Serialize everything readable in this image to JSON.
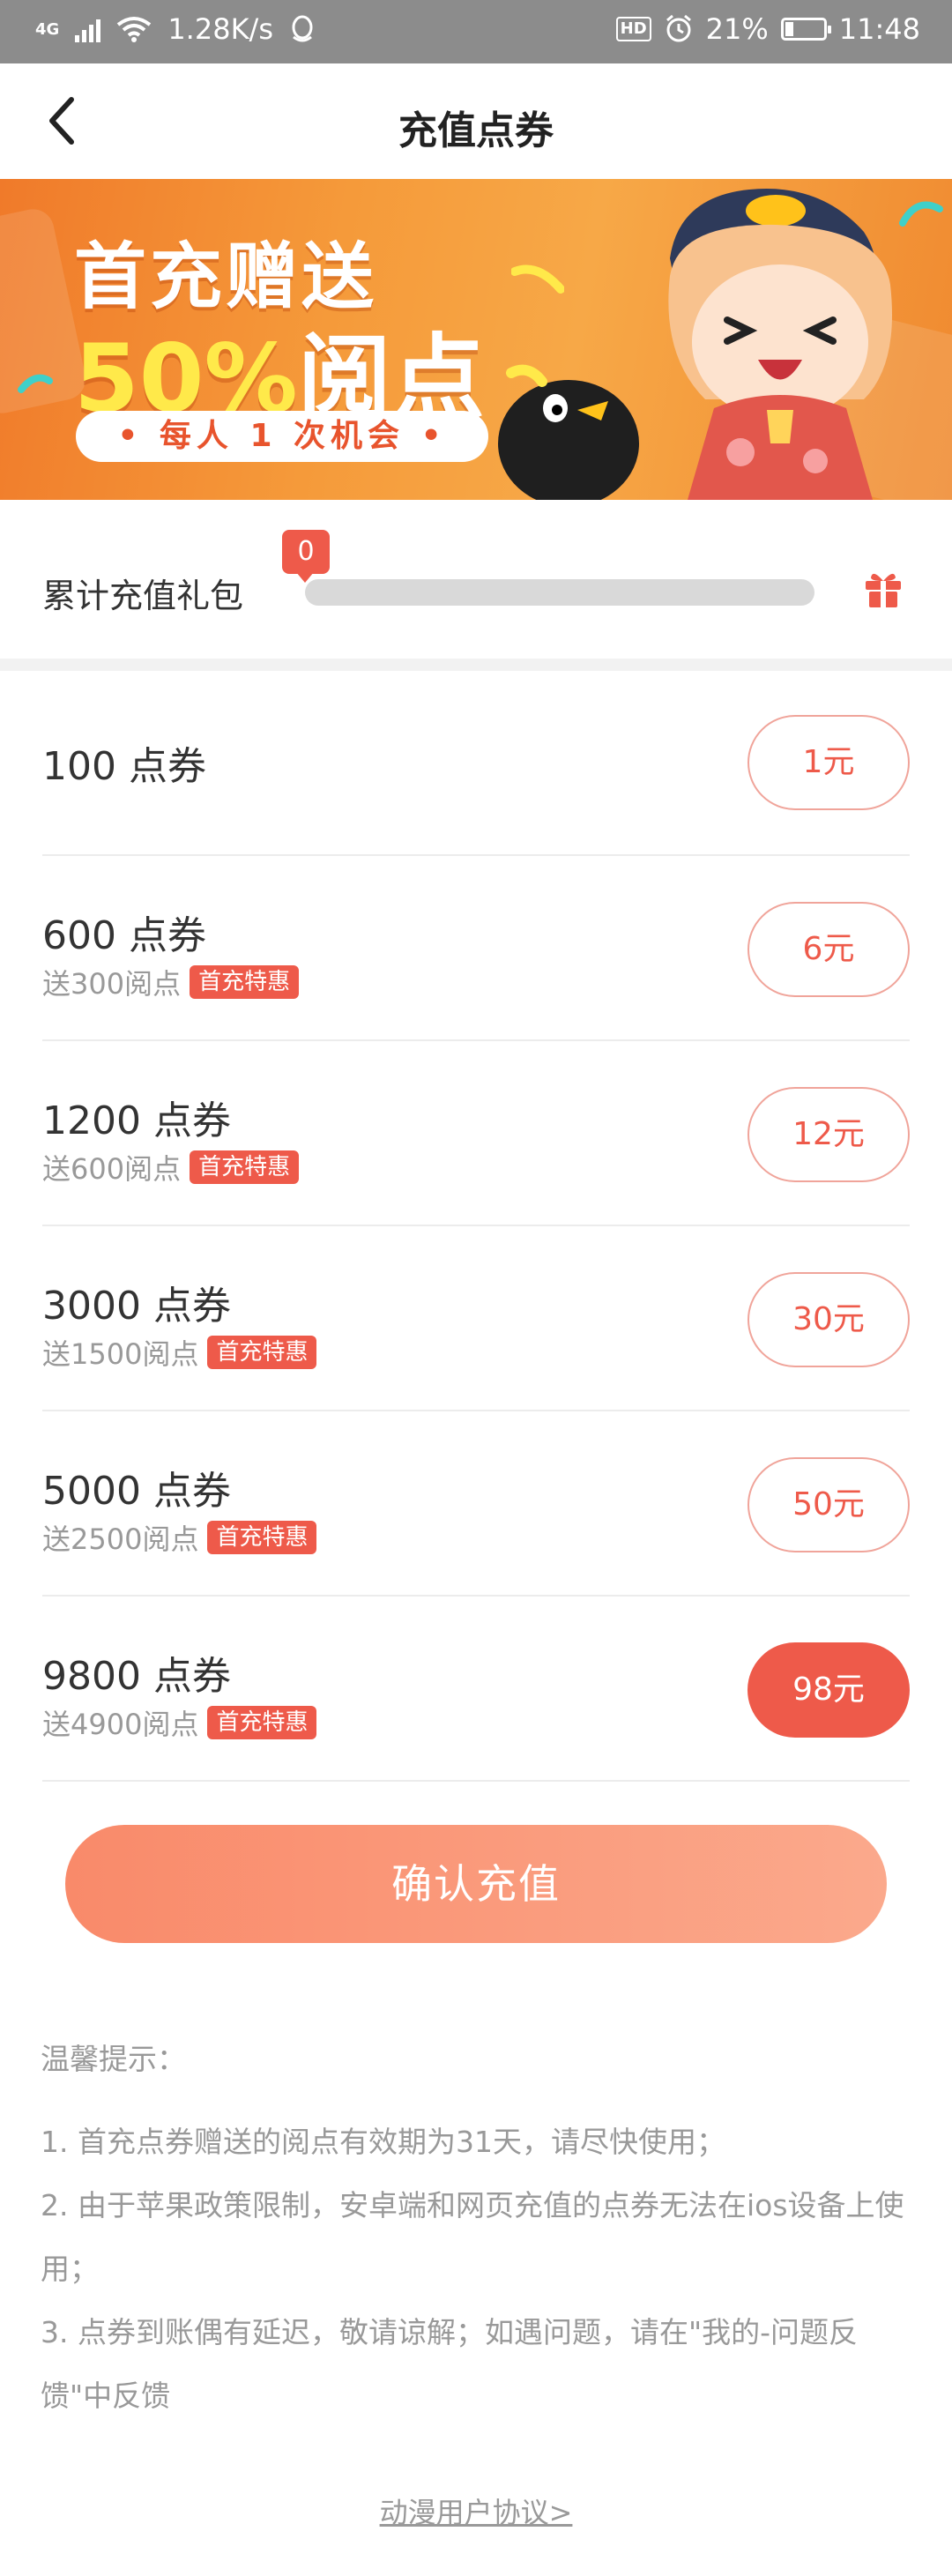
{
  "status_bar": {
    "network": "4G",
    "speed": "1.28K/s",
    "battery": "21%",
    "battery_level": 0.21,
    "time": "11:48",
    "icons": [
      "signal-icon",
      "wifi-icon",
      "qq-icon",
      "hd-icon",
      "alarm-icon",
      "battery-icon"
    ]
  },
  "nav": {
    "back_icon": "chevron-left-icon",
    "title": "充值点券"
  },
  "banner": {
    "line1": "首充赠送",
    "line2_highlight": "50%",
    "line2_rest": "阅点",
    "pill": "• 每人 1 次机会 •"
  },
  "gift": {
    "label": "累计充值礼包",
    "count": "0",
    "progress": 0,
    "icon": "gift-icon"
  },
  "options": [
    {
      "title": "100 点券",
      "bonus": "",
      "badge": "",
      "price": "1元",
      "selected": false
    },
    {
      "title": "600 点券",
      "bonus": "送300阅点",
      "badge": "首充特惠",
      "price": "6元",
      "selected": false
    },
    {
      "title": "1200 点券",
      "bonus": "送600阅点",
      "badge": "首充特惠",
      "price": "12元",
      "selected": false
    },
    {
      "title": "3000 点券",
      "bonus": "送1500阅点",
      "badge": "首充特惠",
      "price": "30元",
      "selected": false
    },
    {
      "title": "5000 点券",
      "bonus": "送2500阅点",
      "badge": "首充特惠",
      "price": "50元",
      "selected": false
    },
    {
      "title": "9800 点券",
      "bonus": "送4900阅点",
      "badge": "首充特惠",
      "price": "98元",
      "selected": true
    }
  ],
  "confirm_label": "确认充值",
  "notes": {
    "heading": "温馨提示：",
    "items": [
      "1. 首充点券赠送的阅点有效期为31天，请尽快使用；",
      "2. 由于苹果政策限制，安卓端和网页充值的点券无法在ios设备上使用；",
      "3. 点券到账偶有延迟，敬请谅解；如遇问题，请在\"我的-问题反馈\"中反馈"
    ]
  },
  "agreement_link": "动漫用户协议>",
  "colors": {
    "accent": "#ee5a4a",
    "confirm_start": "#f98a6a",
    "confirm_end": "#fba98c",
    "banner": "#f38a34",
    "highlight": "#ffe94a"
  }
}
